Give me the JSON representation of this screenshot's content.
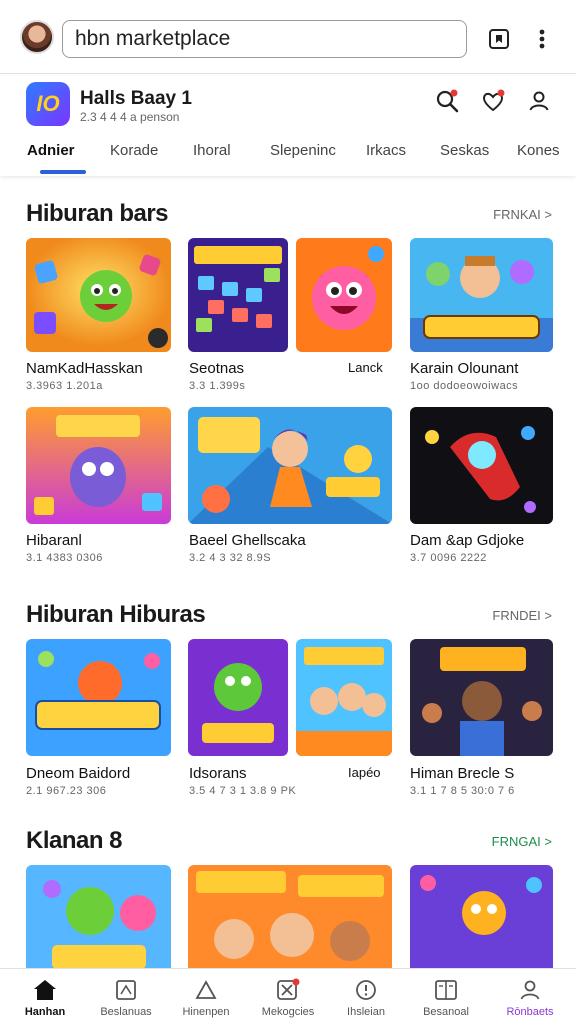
{
  "search": {
    "value": "hbn marketplace"
  },
  "app": {
    "name": "Halls Baay 1",
    "subtitle": "2.3 4 4 4 a penson"
  },
  "tabs": [
    "Adnier",
    "Korade",
    "Ihoral",
    "Slepeninc",
    "Irkacs",
    "Seskas",
    "Kones"
  ],
  "sections": [
    {
      "title": "Hiburan bars",
      "more": "FRNKAI >",
      "items": [
        {
          "name": "NamKadHasskan",
          "meta": "3.3963 1.201a"
        },
        {
          "name": "Seotnas",
          "meta": "3.3 1.399s"
        },
        {
          "name": "Lanck",
          "meta": ""
        },
        {
          "name": "Karain Olounant",
          "meta": "1oo dodoeowoiwacs"
        },
        {
          "name": "Hibaranl",
          "meta": "3.1 4383 0306"
        },
        {
          "name": "Baeel Ghellscaka",
          "meta": "3.2 4 3 32 8.9S"
        },
        {
          "name": "Dam &ap Gdjoke",
          "meta": "3.7 0096 2222"
        }
      ]
    },
    {
      "title": "Hiburan Hiburas",
      "more": "FRNDEI >",
      "items": [
        {
          "name": "Dneom Baidord",
          "meta": "2.1 967.23 306"
        },
        {
          "name": "Idsorans",
          "meta": "3.5 4 7 3 1 3.8 9 PK"
        },
        {
          "name": "Iapéo",
          "meta": ""
        },
        {
          "name": "Himan Brecle S",
          "meta": "3.1 1 7 8 5 30:0 7 6"
        }
      ]
    },
    {
      "title": "Klanan 8",
      "more": "FRNGAI >",
      "items": []
    }
  ],
  "bottom_nav": [
    {
      "label": "Hanhan",
      "icon": "home-icon"
    },
    {
      "label": "Beslanuas",
      "icon": "grid-icon"
    },
    {
      "label": "Hinenpen",
      "icon": "triangle-icon"
    },
    {
      "label": "Mekogcies",
      "icon": "x-badge-icon"
    },
    {
      "label": "Ihsleian",
      "icon": "info-circle-icon"
    },
    {
      "label": "Besanoal",
      "icon": "book-icon"
    },
    {
      "label": "Rōnbaets",
      "icon": "person-icon"
    }
  ],
  "colors": {
    "accent_blue": "#2c5fd8",
    "badge_red": "#e53935",
    "more_green": "#1c8f4a",
    "nav_purple": "#8a3ad6"
  }
}
